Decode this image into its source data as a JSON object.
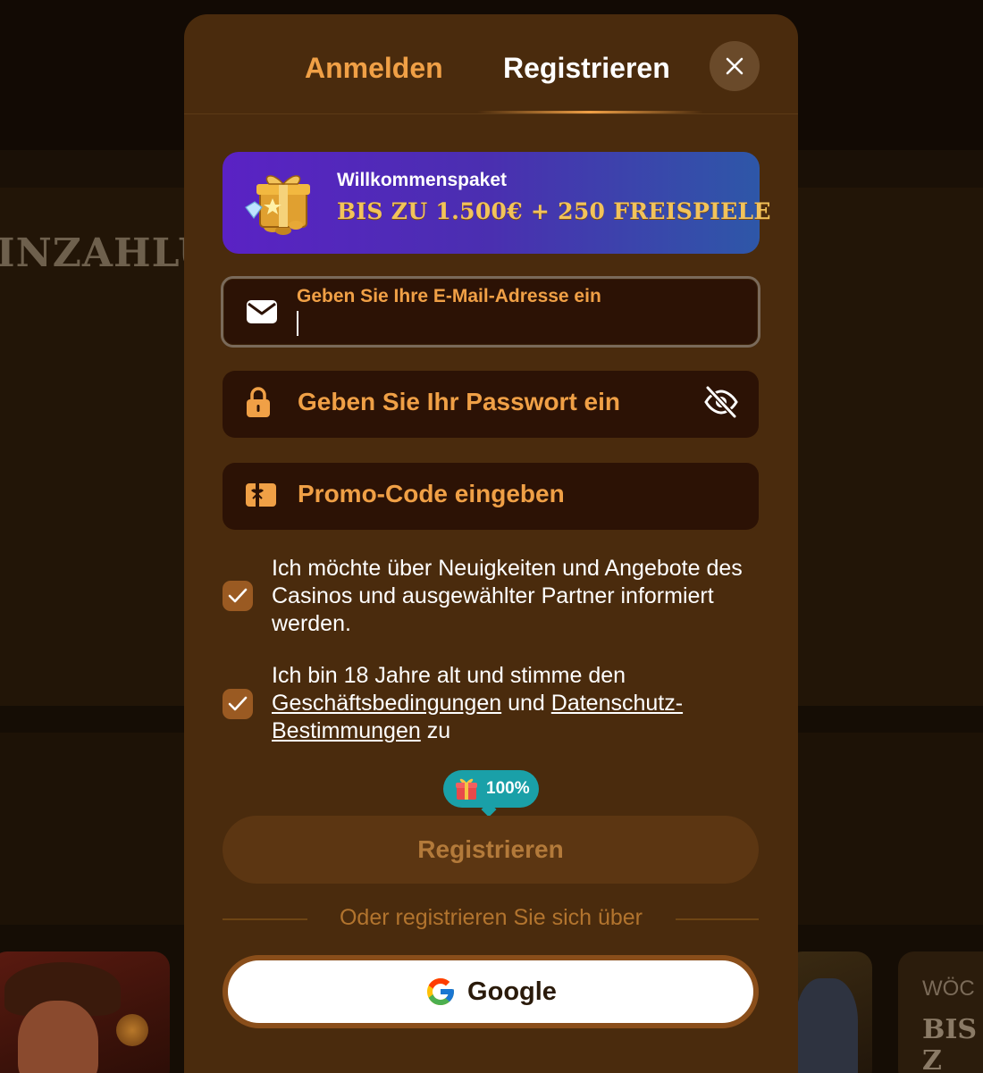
{
  "background": {
    "hero_text": "INZAHLU",
    "card_title": "WÖC",
    "card_subtitle": "BIS Z"
  },
  "tabs": {
    "login": "Anmelden",
    "register": "Registrieren",
    "active": "register"
  },
  "banner": {
    "title": "Willkommenspaket",
    "offer": "BIS ZU 1.500€ + 250 FREISPIELE",
    "icon": "gift-icon"
  },
  "email": {
    "label": "Geben Sie Ihre E-Mail-Adresse ein",
    "value": "",
    "icon": "envelope-icon"
  },
  "password": {
    "placeholder": "Geben Sie Ihr Passwort ein",
    "icon": "lock-icon",
    "visibility_icon": "eye-off-icon"
  },
  "promo": {
    "placeholder": "Promo-Code eingeben",
    "icon": "ticket-icon"
  },
  "consent": {
    "newsletter_text": "Ich möchte über Neuigkeiten und Angebote des Casinos und ausgewählter Partner informiert werden.",
    "newsletter_checked": true,
    "terms_prefix": "Ich bin 18 Jahre alt und stimme den",
    "terms_link": "Geschäftsbedingungen",
    "terms_and": "und",
    "privacy_link": "Datenschutz-Bestimmungen",
    "terms_suffix": "zu",
    "terms_checked": true
  },
  "bonus_badge": {
    "value": "100%"
  },
  "submit": {
    "label": "Registrieren"
  },
  "social": {
    "divider_text": "Oder registrieren Sie sich über",
    "google_label": "Google"
  },
  "colors": {
    "modal_bg": "#4a2b0d",
    "accent": "#f0a046",
    "field_bg": "#2c1205",
    "badge": "#1aa0a8"
  }
}
